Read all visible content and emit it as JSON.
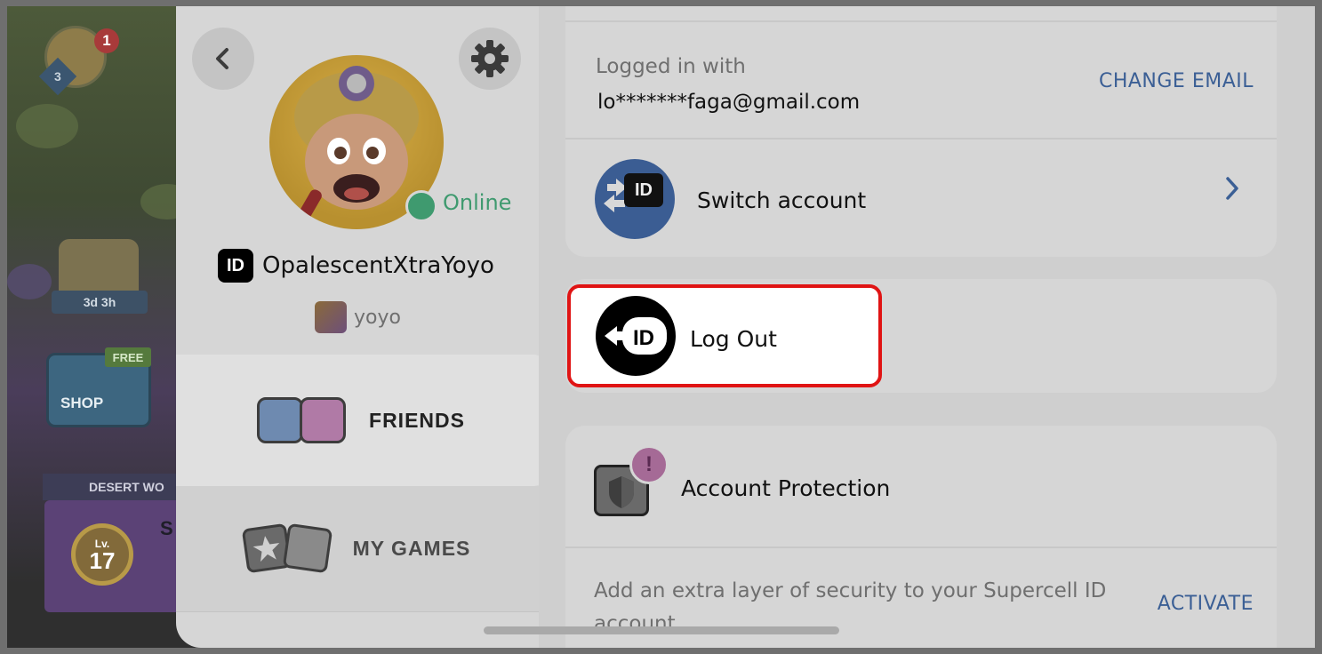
{
  "game": {
    "hero_notification_count": "1",
    "hero_level": "3",
    "event_timer": "3d 3h",
    "shop_free_badge": "FREE",
    "shop_label": "SHOP",
    "desert_banner": "DESERT WO",
    "level_prefix": "Lv.",
    "level_value": "17",
    "desert_partial_letters": "S J"
  },
  "profile": {
    "status": "Online",
    "id_badge": "ID",
    "username": "OpalescentXtraYoyo",
    "game_name": "yoyo"
  },
  "nav": {
    "friends_label": "FRIENDS",
    "my_games_label": "MY GAMES"
  },
  "account": {
    "logged_in_label": "Logged in with",
    "email": "lo*******faga@gmail.com",
    "change_email": "CHANGE EMAIL",
    "switch_account": "Switch account",
    "switch_id": "ID",
    "log_out": "Log Out",
    "logout_id": "ID",
    "alert_mark": "!",
    "account_protection": "Account Protection",
    "protection_desc": "Add an extra layer of security to your Supercell ID account",
    "activate": "ACTIVATE"
  },
  "colors": {
    "accent_blue": "#3b5f95",
    "highlight_red": "#e01414",
    "online_green": "#3f9a6f"
  },
  "icons": [
    "back-chevron-icon",
    "gear-icon",
    "id-icon",
    "switch-account-icon",
    "chevron-right-icon",
    "logout-icon",
    "shield-icon",
    "alert-icon",
    "friends-icon",
    "games-icon"
  ]
}
